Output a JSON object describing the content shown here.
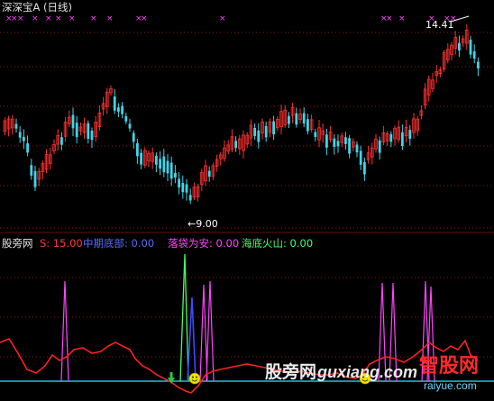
{
  "header": {
    "title": "深深宝A (日线)"
  },
  "price_annotations": {
    "high": "14.41",
    "low": "9.00"
  },
  "indicator": {
    "brand": "股旁网",
    "labels": [
      {
        "name": "S",
        "text": "S: 15.00",
        "color": "#ff3b3b"
      },
      {
        "name": "mid",
        "text": "中期底部: 0.00",
        "color": "#5a6bff"
      },
      {
        "name": "drop",
        "text": "落袋为安: 0.00",
        "color": "#ff44ff"
      },
      {
        "name": "sea",
        "text": "海底火山: 0.00",
        "color": "#44ff66"
      }
    ]
  },
  "watermark": {
    "site_cn": "股旁网",
    "site_en": "guxiang.com",
    "logo_cn": "智股网",
    "logo_en": "raiyue.com"
  },
  "colors": {
    "up": "#ff3030",
    "down": "#3fd5e8",
    "signal_magenta": "#ff44ff",
    "signal_blue": "#3a4bff",
    "signal_green": "#44ff66",
    "line_red": "#ff2020",
    "baseline_cyan": "#38e0ff",
    "dotted": "#8a1818"
  },
  "icons": {
    "top_markers": "x-marker-icon",
    "smile": "smiley-icon",
    "down_arrow": "green-down-arrow-icon"
  }
}
